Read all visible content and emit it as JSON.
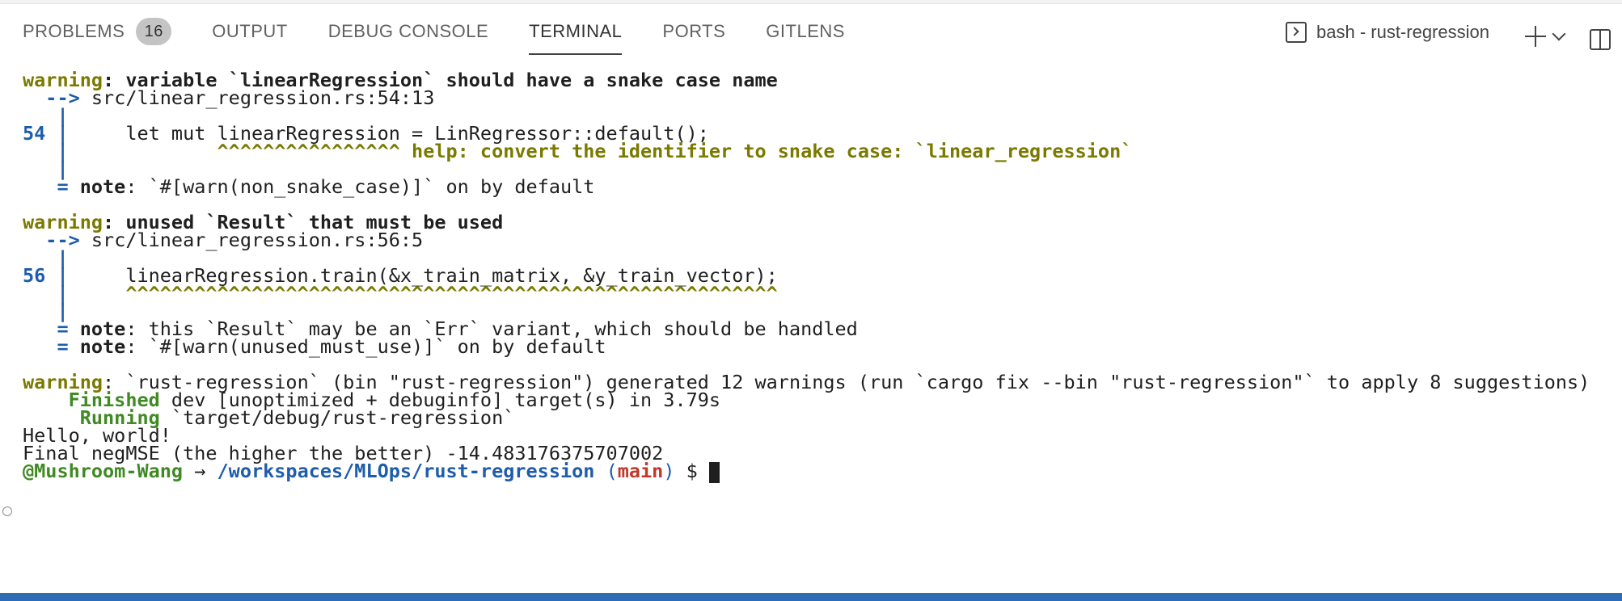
{
  "tabs": [
    {
      "label": "PROBLEMS",
      "badge": "16"
    },
    {
      "label": "OUTPUT"
    },
    {
      "label": "DEBUG CONSOLE"
    },
    {
      "label": "TERMINAL"
    },
    {
      "label": "PORTS"
    },
    {
      "label": "GITLENS"
    }
  ],
  "terminal_picker": {
    "label": "bash - rust-regression"
  },
  "terminal": {
    "l1": {
      "a": "warning",
      "b": ": variable `linearRegression` should have a snake case name"
    },
    "l2": {
      "a": "  -->",
      "b": " src/linear_regression.rs:54:13"
    },
    "l3": {
      "a": "   |"
    },
    "l4": {
      "a": "54 |",
      "b": "     let mut linearRegression = LinRegressor::default();"
    },
    "l5": {
      "a": "   |",
      "b": "             ^^^^^^^^^^^^^^^^ help: convert the identifier to snake case: `linear_regression`"
    },
    "l6": {
      "a": "   |"
    },
    "l7": {
      "a": "   =",
      "b": " note",
      "c": ": `#[warn(non_snake_case)]` on by default"
    },
    "l8": {
      "a": "warning",
      "b": ": unused `Result` that must be used"
    },
    "l9": {
      "a": "  -->",
      "b": " src/linear_regression.rs:56:5"
    },
    "l10": {
      "a": "   |"
    },
    "l11": {
      "a": "56 |",
      "b": "     linearRegression.train(&x_train_matrix, &y_train_vector);"
    },
    "l12": {
      "a": "   |",
      "b": "     ^^^^^^^^^^^^^^^^^^^^^^^^^^^^^^^^^^^^^^^^^^^^^^^^^^^^^^^^^"
    },
    "l13": {
      "a": "   |"
    },
    "l14": {
      "a": "   =",
      "b": " note",
      "c": ": this `Result` may be an `Err` variant, which should be handled"
    },
    "l15": {
      "a": "   =",
      "b": " note",
      "c": ": `#[warn(unused_must_use)]` on by default"
    },
    "l16": {
      "a": "warning",
      "b": ": `rust-regression` (bin \"rust-regression\") generated 12 warnings (run `cargo fix --bin \"rust-regression\"` to apply 8 suggestions)"
    },
    "l17": {
      "a": "    Finished",
      "b": " dev [unoptimized + debuginfo] target(s) in 3.79s"
    },
    "l18": {
      "a": "     Running",
      "b": " `target/debug/rust-regression`"
    },
    "l19": {
      "a": "Hello, world!"
    },
    "l20": {
      "a": "Final negMSE (the higher the better) -14.483176375707002"
    },
    "prompt": {
      "user": "@Mushroom-Wang",
      "arrow": " → ",
      "path": "/workspaces/MLOps/rust-regression",
      "open": " (",
      "branch": "main",
      "close": ")",
      "dollar": " $ "
    }
  }
}
